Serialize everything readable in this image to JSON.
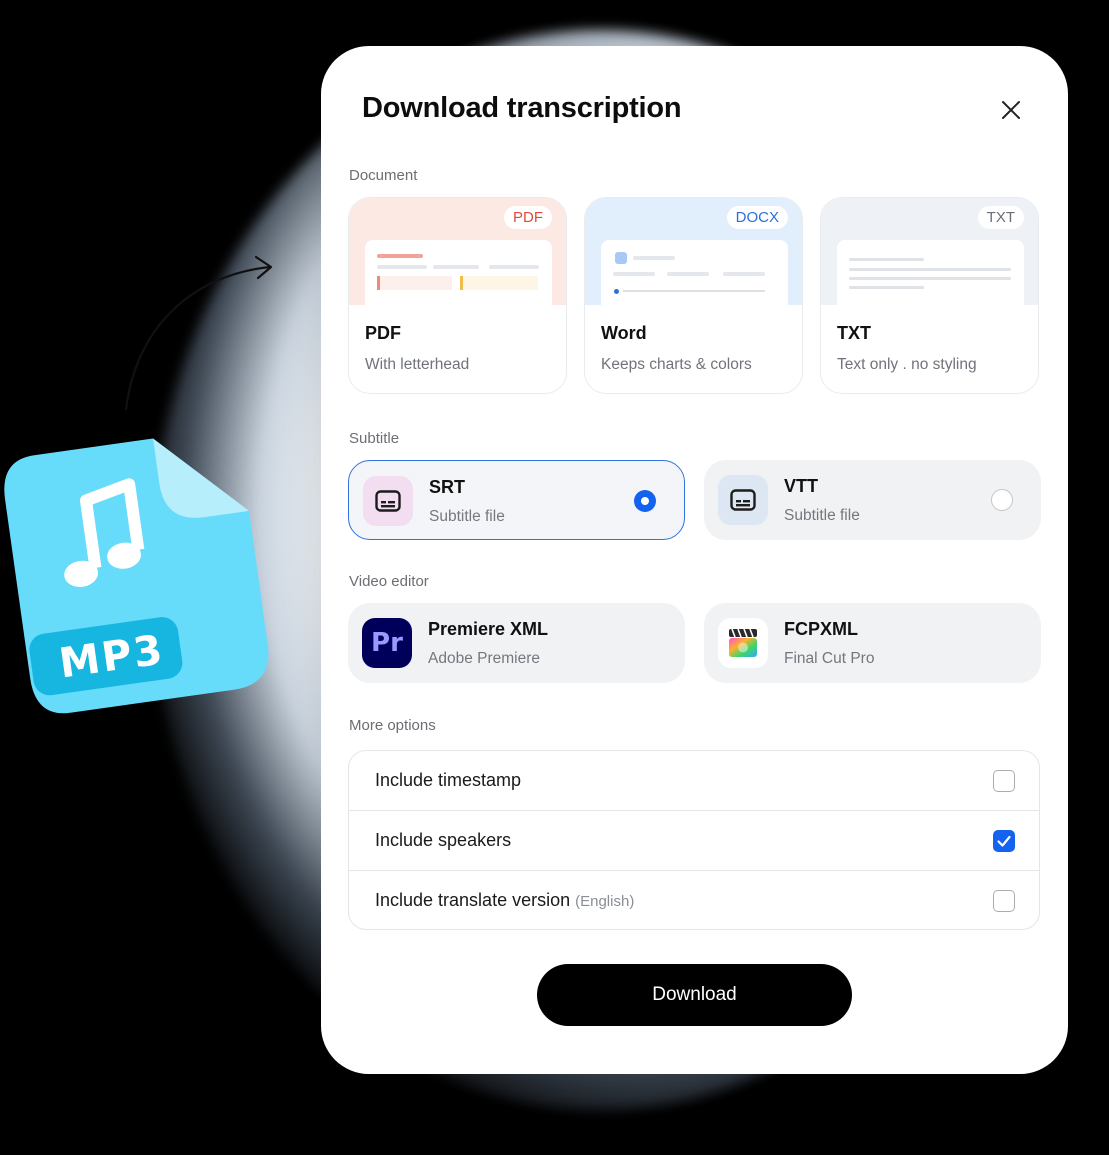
{
  "modal": {
    "title": "Download transcription",
    "close_icon": "close-icon"
  },
  "decoration": {
    "file_badge": "MP3",
    "file_color": "#67dcfa",
    "badge_color": "#17b6e0",
    "music_icon": "music-note-icon"
  },
  "sections": {
    "document": "Document",
    "subtitle": "Subtitle",
    "video_editor": "Video editor",
    "more_options": "More options"
  },
  "documents": [
    {
      "chip": "PDF",
      "name": "PDF",
      "desc": "With letterhead",
      "chip_color": "#e04a3a"
    },
    {
      "chip": "DOCX",
      "name": "Word",
      "desc": "Keeps charts & colors",
      "chip_color": "#2e6fd9"
    },
    {
      "chip": "TXT",
      "name": "TXT",
      "desc": "Text only . no styling",
      "chip_color": "#6a6f77"
    }
  ],
  "subtitles": [
    {
      "name": "SRT",
      "desc": "Subtitle file",
      "selected": true,
      "icon": "subtitles-icon"
    },
    {
      "name": "VTT",
      "desc": "Subtitle file",
      "selected": false,
      "icon": "subtitles-icon"
    }
  ],
  "editors": [
    {
      "name": "Premiere XML",
      "desc": "Adobe Premiere",
      "logo_text": "Pr",
      "icon": "premiere-pro-icon"
    },
    {
      "name": "FCPXML",
      "desc": "Final Cut Pro",
      "icon": "final-cut-pro-icon"
    }
  ],
  "options": [
    {
      "label": "Include timestamp",
      "checked": false
    },
    {
      "label": "Include speakers",
      "checked": true
    },
    {
      "label": "Include translate version",
      "suffix": "(English)",
      "checked": false
    }
  ],
  "download_label": "Download",
  "accent": "#1463f0"
}
